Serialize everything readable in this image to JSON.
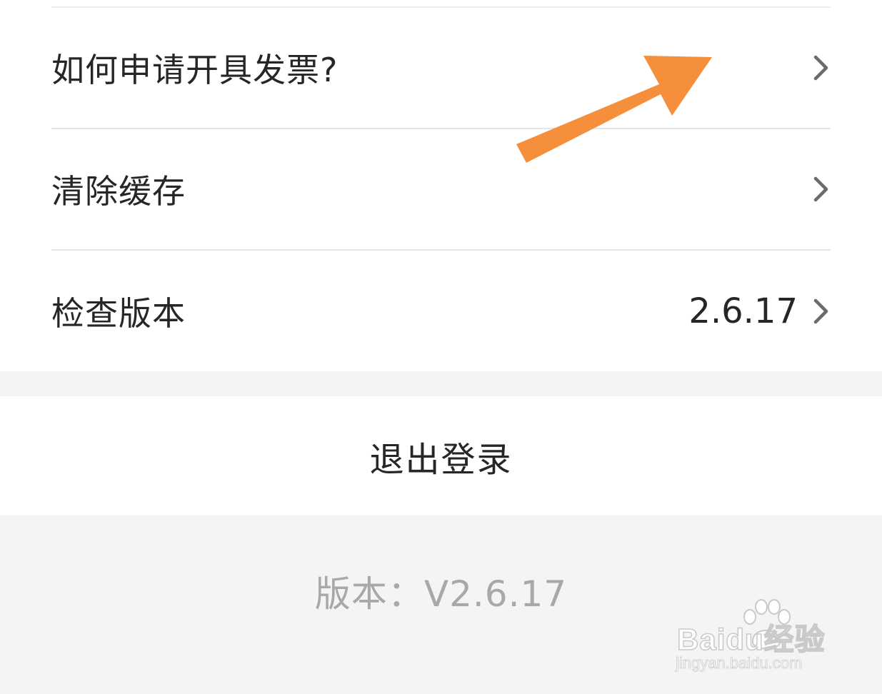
{
  "settings": {
    "items": [
      {
        "label": "如何申请开具发票?",
        "value": ""
      },
      {
        "label": "清除缓存",
        "value": ""
      },
      {
        "label": "检查版本",
        "value": "2.6.17"
      }
    ]
  },
  "logout": {
    "label": "退出登录"
  },
  "footer": {
    "version_text": "版本：V2.6.17"
  },
  "watermark": {
    "brand": "Baidu经验",
    "url": "jingyan.baidu.com"
  },
  "icons": {
    "chevron": "chevron-right-icon",
    "annotation": "arrow-icon",
    "paw": "paw-icon"
  },
  "colors": {
    "annotation_arrow": "#f58f3c",
    "chevron": "#6b6b6b",
    "divider": "#e6e6e6",
    "version_text": "#a8a8a8"
  }
}
